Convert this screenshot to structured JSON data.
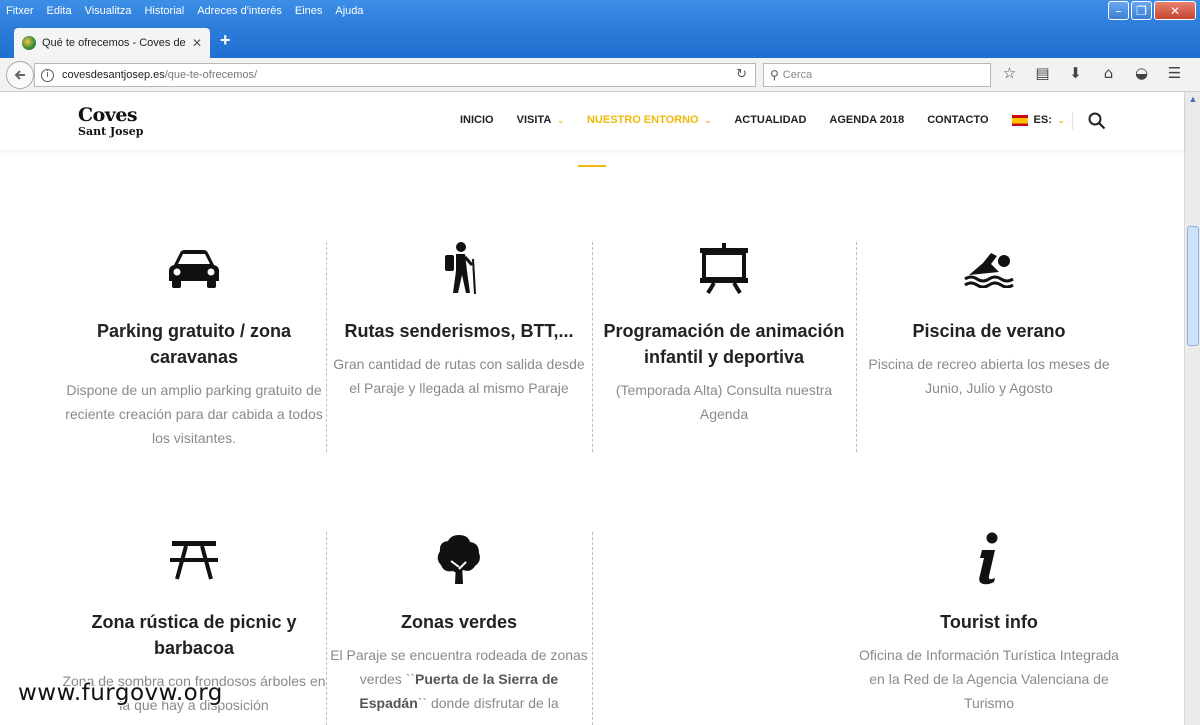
{
  "browser": {
    "menu": [
      "Fitxer",
      "Edita",
      "Visualitza",
      "Historial",
      "Adreces d'interès",
      "Eines",
      "Ajuda"
    ],
    "tab_title": "Qué te ofrecemos - Coves de...",
    "url_domain": "covesdesantjosep.es",
    "url_path": "/que-te-ofrecemos/",
    "search_placeholder": "Cerca"
  },
  "site": {
    "logo_main": "Coves",
    "logo_sub": "Sant Josep",
    "nav": [
      "INICIO",
      "VISITA",
      "NUESTRO ENTORNO",
      "ACTUALIDAD",
      "AGENDA 2018",
      "CONTACTO"
    ],
    "lang": "ES:",
    "accent_color": "#f0b90b"
  },
  "features": [
    {
      "icon": "car-icon",
      "title": "Parking gratuito / zona caravanas",
      "desc": "Dispone de un amplio parking gratuito de reciente creación para dar cabida a todos los visitantes."
    },
    {
      "icon": "hiker-icon",
      "title": "Rutas senderismos, BTT,...",
      "desc": "Gran cantidad de rutas con salida desde el Paraje y llegada al mismo Paraje"
    },
    {
      "icon": "presentation-board-icon",
      "title": "Programación de animación infantil y deportiva",
      "desc": "(Temporada Alta) Consulta nuestra Agenda"
    },
    {
      "icon": "swimmer-icon",
      "title": "Piscina de verano",
      "desc": "Piscina de recreo abierta los meses de Junio, Julio y Agosto"
    },
    {
      "icon": "picnic-table-icon",
      "title": "Zona rústica de picnic y barbacoa",
      "desc": "Zona de sombra con frondosos árboles en la que hay a disposición"
    },
    {
      "icon": "tree-icon",
      "title": "Zonas verdes",
      "desc_a": "El Paraje se encuentra rodeada de zonas verdes ``",
      "desc_b": "Puerta de la Sierra de Espadán",
      "desc_c": "`` donde disfrutar de la"
    },
    {
      "icon": "info-icon",
      "title": "Tourist info",
      "desc": "Oficina de Información Turística Integrada en la Red de la Agencia Valenciana de Turismo"
    }
  ],
  "watermark": "www.furgovw.org"
}
